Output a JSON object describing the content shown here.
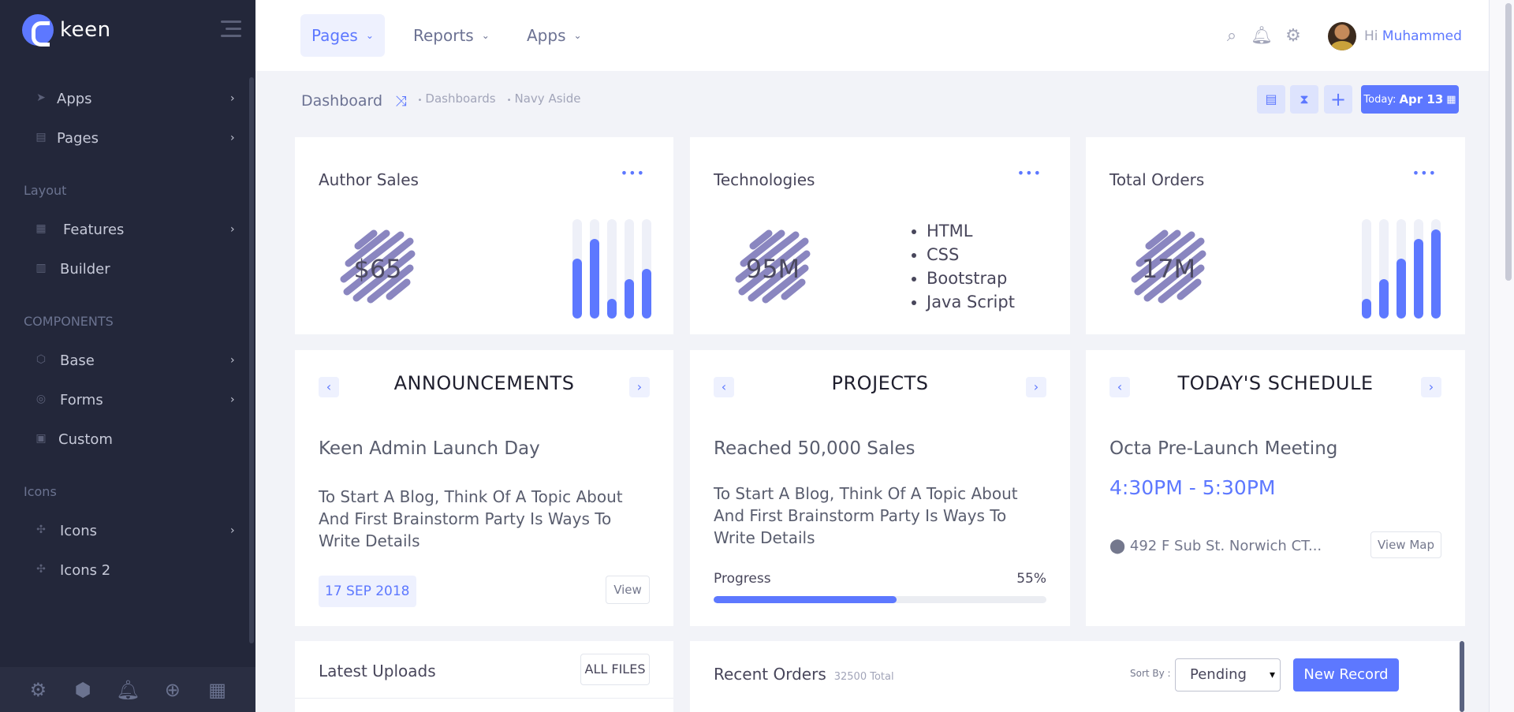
{
  "brand": {
    "name": "keen"
  },
  "sidebar": {
    "items": [
      {
        "label": "Apps",
        "icon": "paper-plane-icon",
        "arrow": "›"
      },
      {
        "label": "Pages",
        "icon": "document-icon",
        "arrow": "›"
      },
      {
        "label": "Features",
        "icon": "boxes-icon",
        "arrow": "›"
      },
      {
        "label": "Builder",
        "icon": "bar-chart-icon"
      },
      {
        "label": "Base",
        "icon": "cube-icon",
        "arrow": "›"
      },
      {
        "label": "Forms",
        "icon": "stack-icon",
        "arrow": "›"
      },
      {
        "label": "Custom",
        "icon": "briefcase-icon"
      },
      {
        "label": "Icons",
        "icon": "puzzle-icon",
        "arrow": "›"
      },
      {
        "label": "Icons 2",
        "icon": "puzzle-icon"
      }
    ],
    "sections": [
      "Layout",
      "COMPONENTS",
      "Icons"
    ],
    "footer_icons": [
      "gears-icon",
      "box-icon",
      "bell-icon",
      "plus-circle-icon",
      "calendar-plus-icon"
    ]
  },
  "topnav": {
    "items": [
      {
        "label": "Pages",
        "active": true
      },
      {
        "label": "Reports",
        "active": false
      },
      {
        "label": "Apps",
        "active": false
      }
    ],
    "icons": [
      "search-icon",
      "bell-icon",
      "gears-icon"
    ],
    "greeting": "Hi",
    "user": "Muhammed"
  },
  "subheader": {
    "title": "Dashboard",
    "crumbs": [
      "Dashboards",
      "Navy Aside"
    ],
    "today_label": "Today:",
    "today_date": "Apr 13"
  },
  "widgets": {
    "author_sales": {
      "title": "Author Sales",
      "value": "$65",
      "bars": [
        0.6,
        0.8,
        0.2,
        0.4,
        0.5
      ]
    },
    "technologies": {
      "title": "Technologies",
      "value": "95M",
      "list": [
        "HTML",
        "CSS",
        "Bootstrap",
        "Java Script"
      ]
    },
    "total_orders": {
      "title": "Total Orders",
      "value": "17M",
      "bars": [
        0.2,
        0.4,
        0.6,
        0.8,
        0.9
      ]
    }
  },
  "announcements": {
    "title": "ANNOUNCEMENTS",
    "heading": "Keen Admin Launch Day",
    "text": "To Start A Blog, Think Of A Topic About And First Brainstorm Party Is Ways To Write Details",
    "date": "17 SEP 2018",
    "button": "View"
  },
  "projects": {
    "title": "PROJECTS",
    "heading": "Reached 50,000 Sales",
    "text": "To Start A Blog, Think Of A Topic About And First Brainstorm Party Is Ways To Write Details",
    "progress_label": "Progress",
    "progress_text": "55%",
    "progress": 0.55
  },
  "schedule": {
    "title": "TODAY'S SCHEDULE",
    "heading": "Octa Pre-Launch Meeting",
    "time": "4:30PM - 5:30PM",
    "address": "492 F Sub St. Norwich CT...",
    "button": "View Map"
  },
  "uploads": {
    "title": "Latest Uploads",
    "button": "ALL FILES"
  },
  "orders": {
    "title": "Recent Orders",
    "total": "32500 Total",
    "sort_label": "Sort By :",
    "sort_value": "Pending",
    "button": "New Record"
  },
  "colors": {
    "accent": "#5d78ff",
    "sidebar": "#23273a",
    "background": "#f2f3f8"
  }
}
